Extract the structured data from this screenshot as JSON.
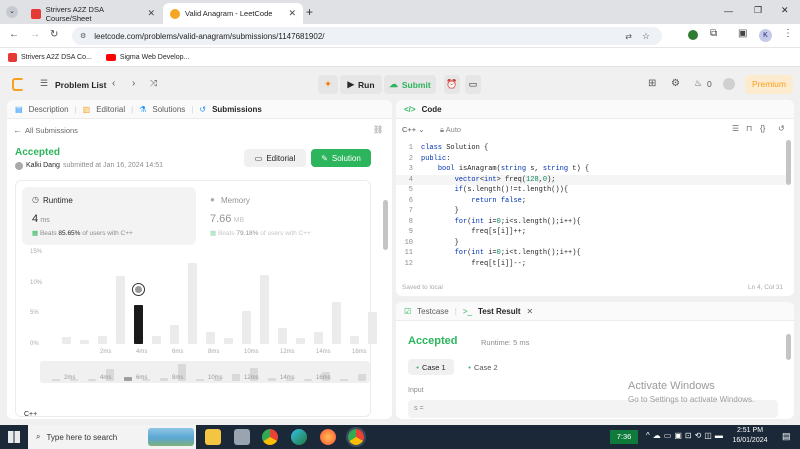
{
  "browser": {
    "tabs": [
      {
        "title": "Strivers A2Z DSA Course/Sheet"
      },
      {
        "title": "Valid Anagram - LeetCode"
      }
    ],
    "url": "leetcode.com/problems/valid-anagram/submissions/1147681902/",
    "bookmarks": [
      {
        "label": "Strivers A2Z DSA Co..."
      },
      {
        "label": "Sigma Web Develop..."
      }
    ],
    "profile_initial": "K"
  },
  "lc_nav": {
    "problem_list": "Problem List",
    "run": "Run",
    "submit": "Submit",
    "streak_count": "0",
    "premium": "Premium"
  },
  "left_panel": {
    "tabs": [
      "Description",
      "Editorial",
      "Solutions",
      "Submissions"
    ],
    "all_submissions": "All Submissions",
    "status": "Accepted",
    "author": "Kalki Dang",
    "submitted_at": "submitted at Jan 16, 2024 14:51",
    "editorial_btn": "Editorial",
    "solution_btn": "Solution",
    "runtime": {
      "label": "Runtime",
      "value": "4",
      "unit": "ms",
      "beats_prefix": "Beats",
      "beats_pct": "85.65%",
      "beats_suffix": "of users with C++"
    },
    "memory": {
      "label": "Memory",
      "value": "7.66",
      "unit": "MB",
      "beats_prefix": "Beats",
      "beats_pct": "79.18%",
      "beats_suffix": "of users with C++"
    },
    "bottom_lang": "C++"
  },
  "chart_data": {
    "type": "bar",
    "ylabel_ticks": [
      "15%",
      "10%",
      "5%",
      "0%"
    ],
    "ylim": [
      0,
      15
    ],
    "x_tick_labels": [
      "2ms",
      "4ms",
      "6ms",
      "8ms",
      "10ms",
      "12ms",
      "14ms",
      "16ms"
    ],
    "values": [
      1.2,
      0.7,
      1.4,
      11.2,
      6.4,
      1.3,
      3.1,
      13.3,
      2.0,
      1.0,
      5.4,
      11.3,
      2.7,
      1.0,
      2.0,
      6.9,
      1.3,
      5.3
    ],
    "highlight_index": 4,
    "mini_values": [
      0.5,
      0.4,
      0.8,
      5.5,
      2.0,
      0.4,
      1.5,
      7.5,
      0.8,
      0.4,
      3.0,
      6.0,
      1.3,
      0.5,
      0.8,
      4.0,
      0.5,
      3.0
    ],
    "mini_tick_labels": [
      "2ms",
      "4ms",
      "6ms",
      "8ms",
      "10ms",
      "12ms",
      "14ms",
      "16ms"
    ]
  },
  "code_panel": {
    "title": "Code",
    "language": "C++",
    "auto": "Auto",
    "lines": [
      "class Solution {",
      "public:",
      "    bool isAnagram(string s, string t) {",
      "        vector<int> freq(128,0);",
      "        if(s.length()!=t.length()){",
      "            return false;",
      "        }",
      "        for(int i=0;i<s.length();i++){",
      "            freq[s[i]]++;",
      "        }",
      "        for(int i=0;i<t.length();i++){",
      "            freq[t[i]]--;"
    ],
    "saved": "Saved to local",
    "cursor": "Ln 4, Col 31"
  },
  "test_panel": {
    "tabs": [
      "Testcase",
      "Test Result"
    ],
    "status": "Accepted",
    "runtime": "Runtime: 5 ms",
    "cases": [
      "Case 1",
      "Case 2"
    ],
    "input_label": "Input",
    "input_value": "s ="
  },
  "watermark": {
    "title": "Activate Windows",
    "subtitle": "Go to Settings to activate Windows."
  },
  "taskbar": {
    "search": "Type here to search",
    "timer": "7:36",
    "time": "2:51 PM",
    "date": "16/01/2024"
  }
}
